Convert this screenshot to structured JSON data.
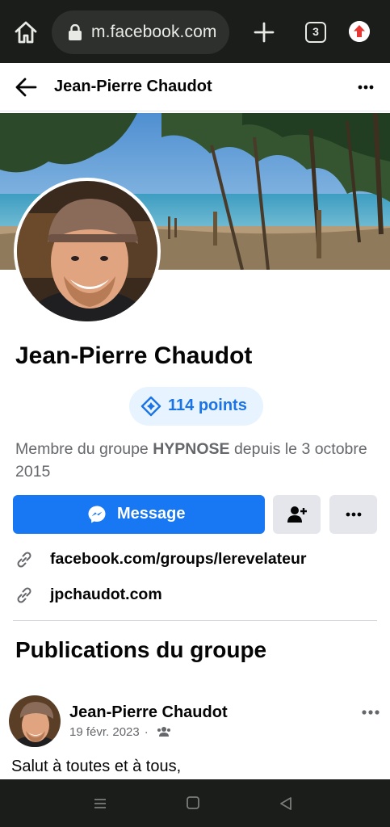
{
  "browser": {
    "url": "m.facebook.com",
    "tab_count": "3"
  },
  "header": {
    "title": "Jean-Pierre Chaudot"
  },
  "profile": {
    "name": "Jean-Pierre Chaudot",
    "points": "114 points",
    "member_prefix": "Membre du groupe ",
    "group_name": "HYPNOSE",
    "member_suffix": " depuis le 3 octobre 2015",
    "message_label": "Message",
    "links": [
      {
        "text": "facebook.com/groups/lerevelateur"
      },
      {
        "text": "jpchaudot.com"
      }
    ]
  },
  "section": {
    "title": "Publications du groupe"
  },
  "post": {
    "author": "Jean-Pierre Chaudot",
    "date": "19 févr. 2023",
    "dot": "·",
    "text": "Salut à toutes et à tous,"
  },
  "colors": {
    "primary": "#1877f2",
    "points_bg": "#e7f3ff",
    "points_text": "#1b74e4",
    "secondary_button": "#e4e6eb",
    "muted_text": "#65676b",
    "chrome_bg": "#1b1d1b"
  }
}
